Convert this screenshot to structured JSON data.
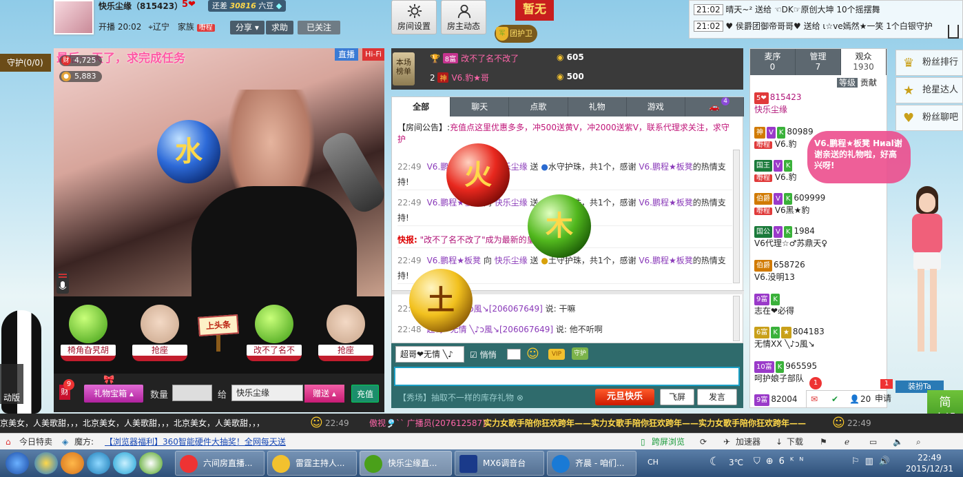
{
  "header": {
    "anchor_name": "快乐尘缘（815423）",
    "level_tag": "5❤",
    "beans_prefix": "还差",
    "beans_value": "30816",
    "beans_suffix": "六豆",
    "open_time": "开播 20:02",
    "location": "辽宁",
    "family_label": "家族",
    "family_tag": "嘢程",
    "share_label": "分享",
    "help_label": "求助",
    "follow_label": "已关注",
    "room_settings": "房间设置",
    "host_news": "房主动态",
    "guard_group": "团护卫",
    "red_banner": "暂无"
  },
  "notifications": [
    {
      "time": "21:02",
      "text": "晴天~² 送给 ☜DK☞原创大坤 10个摇摆舞"
    },
    {
      "time": "21:02",
      "text": "♥ 侯爵团御帝哥哥♥ 送给 ι☆ve嫣然★一笑 1个白银守护"
    }
  ],
  "guard": {
    "label": "守护(0/0)"
  },
  "video": {
    "title": "最后一天了，求完成任务",
    "live": "直播",
    "hifi": "Hi-Fi",
    "stat1": "4,725",
    "stat2": "5,883"
  },
  "seats": [
    {
      "label": "椅角旮旯胡"
    },
    {
      "label": "抢座"
    },
    {
      "label": "改不了名不"
    },
    {
      "label": "抢座"
    }
  ],
  "headline": "上头条",
  "giftbar": {
    "gift_badge": "9",
    "gift_box": "礼物宝箱",
    "quantity_label": "数量",
    "to_label": "给",
    "recipient": "快乐尘缘",
    "send": "赠送",
    "recharge": "充值",
    "side_label": "财"
  },
  "rank": {
    "badge": "本场榜单",
    "rows": [
      {
        "pos": "",
        "tag": "8富",
        "name": "改不了名不改了",
        "coins": "605"
      },
      {
        "pos": "2",
        "tag": "神",
        "name": "V6.豹★哥",
        "coins": "500"
      }
    ]
  },
  "chat": {
    "tabs": [
      "全部",
      "聊天",
      "点歌",
      "礼物",
      "游戏"
    ],
    "car_badge": "4",
    "notice_label": "【房间公告】:",
    "notice_text": "充值点这里优惠多多，冲500送黄V，冲2000送紫V，联系代理求关注，求守护",
    "messages": [
      {
        "time": "22:49",
        "user": "V6.鹏程★板凳",
        "verb": "向",
        "target": "快乐尘缘",
        "act": "送",
        "item": "水守护珠，共1个，感谢",
        "thanks": "V6.鹏程★板凳",
        "end": "的热情支持!"
      },
      {
        "time": "22:49",
        "user": "V6.鹏程★板凳",
        "verb": "向",
        "target": "快乐尘缘",
        "act": "送",
        "item": "木守护珠，共1个，感谢",
        "thanks": "V6.鹏程★板凳",
        "end": "的热情支持!"
      },
      {
        "time": "22:49",
        "user": "V6.鹏程★板凳",
        "verb": "向",
        "target": "快乐尘缘",
        "act": "送",
        "item": "土守护珠，共1个，感谢",
        "thanks": "V6.鹏程★板凳",
        "end": "的热情支持!"
      }
    ],
    "flash_label": "快报:",
    "flash_text": "\"改不了名不改了\"成为最新的皇",
    "lower": [
      {
        "time": "22:",
        "user": "超哥❤无情 ╲♪ɔ風↘[206067649]",
        "text": "说: 干嘛"
      },
      {
        "time": "22:48",
        "user": "超哥❤无情 ╲♪ɔ風↘[206067649]",
        "text": "说: 他不听啊"
      }
    ]
  },
  "input": {
    "to_user": "超哥❤无情 ╲♪",
    "whisper": "悄悄",
    "promo": "【秀场】抽取不一样的库存礼物",
    "yuandan": "元旦快乐",
    "fly": "飞屏",
    "speak": "发言"
  },
  "users": {
    "tabs": [
      {
        "label": "麦序",
        "count": "0"
      },
      {
        "label": "管理",
        "count": "7"
      },
      {
        "label": "观众",
        "count": "1930"
      }
    ],
    "sub_tabs": [
      "等级",
      "贡献"
    ],
    "rows": [
      {
        "level": "5❤",
        "id": "815423",
        "name": "快乐尘缘"
      },
      {
        "level": "神",
        "id": "80989",
        "name": "V6.豹"
      },
      {
        "level": "国王",
        "id": "",
        "name": "V6.豹"
      },
      {
        "level": "伯爵",
        "id": "609999",
        "name": "V6黑★豹"
      },
      {
        "level": "国公",
        "id": "1984",
        "name": "V6代理☆♂苏鼎天♀"
      },
      {
        "level": "伯爵",
        "id": "658726",
        "name": "V6.没明13"
      },
      {
        "level": "9富",
        "id": "",
        "name": "志在❤必得"
      },
      {
        "level": "6富",
        "id": "804183",
        "name": "无情XX ╲♪ɔ風↘"
      },
      {
        "level": "10富",
        "id": "965595",
        "name": "呵护娘子部队"
      },
      {
        "level": "9富",
        "id": "82004",
        "name": ""
      }
    ],
    "footer_count": "20",
    "apply": "申请",
    "apply_badge": "1",
    "mail_badge": "1"
  },
  "bubble": "V6.鹏程★板凳 Ниаl谢谢亲送的礼物啦，好高兴呀!",
  "right_panel": [
    {
      "label": "粉丝排行"
    },
    {
      "label": "抢星达人"
    },
    {
      "label": "粉丝聊吧"
    }
  ],
  "dress": "装扮Ta",
  "simple": "简\n中设",
  "marquee_left": "京美女，人美歌甜，，，北京美女，人美歌甜，，，北京美女，人美歌甜，，，",
  "marquee_time_left": "22:49",
  "marquee_user": "傲视🎐`` 广播员(207612587):",
  "marquee_right": "实力女歌手陪你狂欢跨年——实力女歌手陪你狂欢跨年——实力女歌手陪你狂欢跨年——",
  "marquee_time_right": "22:49",
  "browser": {
    "daily": "今日特卖",
    "magic": "魔方:",
    "link": "【浏览器福利】360智能硬件大抽奖！全网每天送",
    "cross": "跨屏浏览",
    "accel": "加速器",
    "download": "下载"
  },
  "taskbar": {
    "items": [
      "六间房直播...",
      "雷霆主持人...",
      "快乐尘缘直...",
      "MX6调音台",
      "齐晨 - 咱们..."
    ],
    "temp": "3℃",
    "ime": "CH",
    "time": "22:49",
    "date": "2015/12/31"
  },
  "orbs": [
    "水",
    "火",
    "木",
    "土"
  ],
  "left_edge": "动版"
}
